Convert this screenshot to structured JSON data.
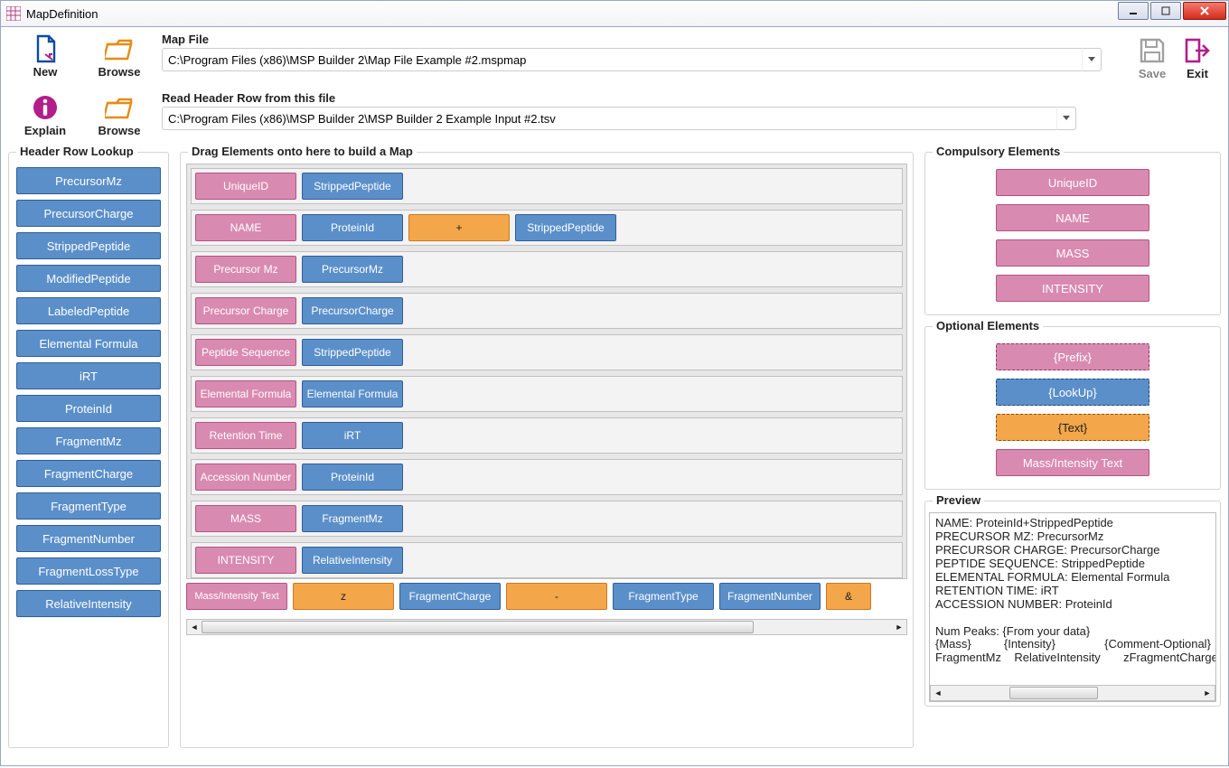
{
  "window": {
    "title": "MapDefinition"
  },
  "toolbar": {
    "new": "New",
    "browse": "Browse",
    "explain": "Explain",
    "save": "Save",
    "exit": "Exit"
  },
  "map_file": {
    "label": "Map File",
    "value": "C:\\Program Files (x86)\\MSP Builder 2\\Map File Example #2.mspmap"
  },
  "header_file": {
    "label": "Read Header Row from this file",
    "value": "C:\\Program Files (x86)\\MSP Builder 2\\MSP Builder 2 Example Input #2.tsv"
  },
  "lookup": {
    "title": "Header Row Lookup",
    "items": [
      "PrecursorMz",
      "PrecursorCharge",
      "StrippedPeptide",
      "ModifiedPeptide",
      "LabeledPeptide",
      "Elemental Formula",
      "iRT",
      "ProteinId",
      "FragmentMz",
      "FragmentCharge",
      "FragmentType",
      "FragmentNumber",
      "FragmentLossType",
      "RelativeIntensity"
    ]
  },
  "build": {
    "title": "Drag Elements onto here to build a Map",
    "rows": [
      [
        {
          "t": "UniqueID",
          "c": "pink"
        },
        {
          "t": "StrippedPeptide",
          "c": "blue"
        }
      ],
      [
        {
          "t": "NAME",
          "c": "pink"
        },
        {
          "t": "ProteinId",
          "c": "blue"
        },
        {
          "t": "+",
          "c": "orange"
        },
        {
          "t": "StrippedPeptide",
          "c": "blue"
        }
      ],
      [
        {
          "t": "Precursor Mz",
          "c": "pink"
        },
        {
          "t": "PrecursorMz",
          "c": "blue"
        }
      ],
      [
        {
          "t": "Precursor Charge",
          "c": "pink"
        },
        {
          "t": "PrecursorCharge",
          "c": "blue"
        }
      ],
      [
        {
          "t": "Peptide Sequence",
          "c": "pink"
        },
        {
          "t": "StrippedPeptide",
          "c": "blue"
        }
      ],
      [
        {
          "t": "Elemental Formula",
          "c": "pink"
        },
        {
          "t": "Elemental Formula",
          "c": "blue"
        }
      ],
      [
        {
          "t": "Retention Time",
          "c": "pink"
        },
        {
          "t": "iRT",
          "c": "blue"
        }
      ],
      [
        {
          "t": "Accession Number",
          "c": "pink"
        },
        {
          "t": "ProteinId",
          "c": "blue"
        }
      ],
      [
        {
          "t": "MASS",
          "c": "pink"
        },
        {
          "t": "FragmentMz",
          "c": "blue"
        }
      ],
      [
        {
          "t": "INTENSITY",
          "c": "pink"
        },
        {
          "t": "RelativeIntensity",
          "c": "blue"
        }
      ]
    ],
    "last_row": [
      {
        "t": "Mass/Intensity Text",
        "c": "pink",
        "small": true
      },
      {
        "t": "z",
        "c": "orange"
      },
      {
        "t": "FragmentCharge",
        "c": "blue"
      },
      {
        "t": "-",
        "c": "orange"
      },
      {
        "t": "FragmentType",
        "c": "blue"
      },
      {
        "t": "FragmentNumber",
        "c": "blue"
      },
      {
        "t": "&",
        "c": "orange",
        "w": 50
      }
    ]
  },
  "compulsory": {
    "title": "Compulsory Elements",
    "items": [
      "UniqueID",
      "NAME",
      "MASS",
      "INTENSITY"
    ]
  },
  "optional": {
    "title": "Optional Elements",
    "items": [
      {
        "t": "{Prefix}",
        "c": "pink",
        "dashed": true
      },
      {
        "t": "{LookUp}",
        "c": "blue",
        "dashed": true
      },
      {
        "t": "{Text}",
        "c": "orange",
        "dashed": true
      },
      {
        "t": "Mass/Intensity Text",
        "c": "pink",
        "dashed": false
      }
    ]
  },
  "preview": {
    "title": "Preview",
    "text": "NAME: ProteinId+StrippedPeptide\nPRECURSOR MZ: PrecursorMz\nPRECURSOR CHARGE: PrecursorCharge\nPEPTIDE SEQUENCE: StrippedPeptide\nELEMENTAL FORMULA: Elemental Formula\nRETENTION TIME: iRT\nACCESSION NUMBER: ProteinId\n\nNum Peaks: {From your data}\n{Mass}          {Intensity}               {Comment-Optional}\nFragmentMz    RelativeIntensity       zFragmentCharge - Frag"
  }
}
